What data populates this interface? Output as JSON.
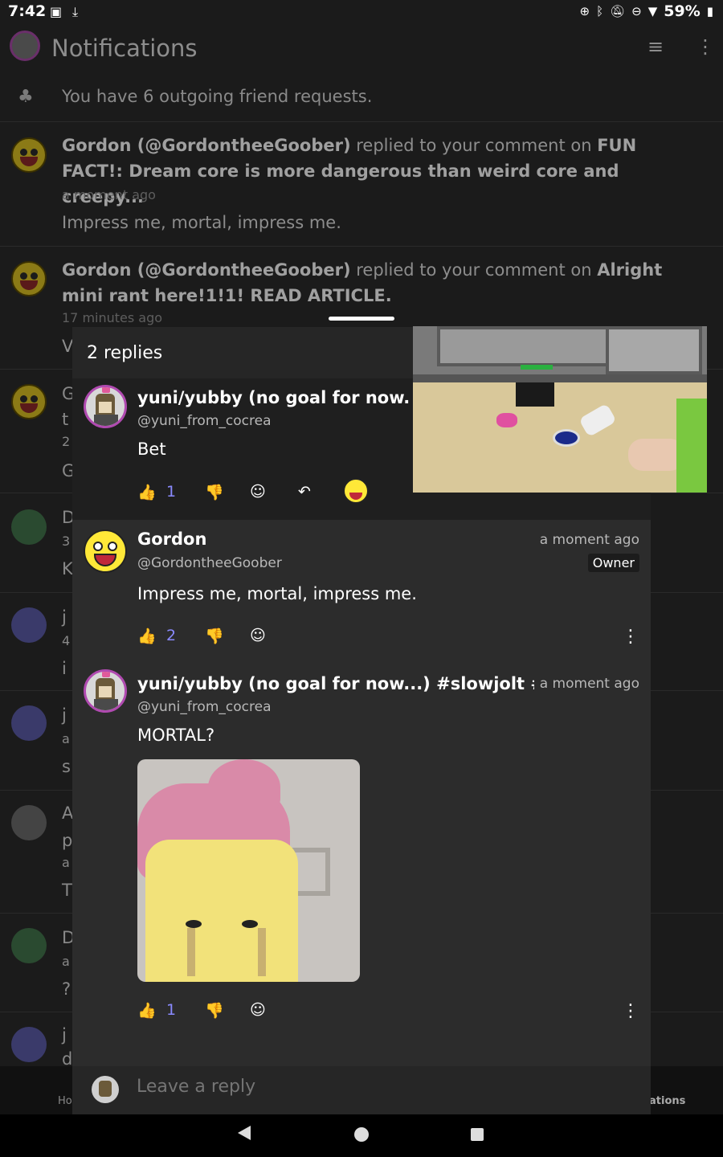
{
  "status_bar": {
    "time": "7:42",
    "battery": "59%",
    "icons": [
      "image-icon",
      "download-icon",
      "data-saver-icon",
      "bluetooth-icon",
      "mute-icon",
      "dnd-icon",
      "wifi-icon",
      "battery-icon"
    ]
  },
  "app_bar": {
    "title": "Notifications"
  },
  "friend_requests": {
    "text": "You have 6 outgoing friend requests."
  },
  "notifications": [
    {
      "user": "Gordon (@GordontheeGoober)",
      "action": " replied to your comment on ",
      "target": "FUN FACT!: Dream core is more dangerous than weird core and creepy...",
      "time": "a moment ago",
      "body": "Impress me, mortal, impress me."
    },
    {
      "user": "Gordon (@GordontheeGoober)",
      "action": " replied to your comment on ",
      "target": "Alright mini rant here!1!1! READ ARTICLE.",
      "time": "17 minutes ago",
      "body": "V"
    }
  ],
  "partial_letters": [
    "G",
    "t",
    "2",
    "G",
    "D",
    "3",
    "K",
    "j",
    "4",
    "i",
    "j",
    "a",
    "s",
    "A",
    "p",
    "a",
    "T",
    "D",
    "a",
    "?",
    "j",
    "d"
  ],
  "bottom_nav": {
    "left_label": "Ho",
    "right_label": "ations"
  },
  "sheet": {
    "title": "2 replies",
    "replies": [
      {
        "name": "yuni/yubby (no goal for now...) #s",
        "handle": "@yuni_from_cocrea",
        "text": "Bet",
        "likes": "1"
      },
      {
        "name": "Gordon",
        "handle": "@GordontheeGoober",
        "time": "a moment ago",
        "badge": "Owner",
        "text": "Impress me, mortal, impress me.",
        "likes": "2"
      },
      {
        "name": "yuni/yubby (no goal for now...) #slowjolt #Down",
        "handle": "@yuni_from_cocrea",
        "time": "a moment ago",
        "text": "MORTAL?",
        "likes": "1"
      }
    ],
    "reply_placeholder": "Leave a reply"
  },
  "icons": {
    "like": "👍",
    "dislike": "👎",
    "react": "☺",
    "reply": "↶",
    "more": "⋮",
    "filter": "≡",
    "group": "♣"
  }
}
